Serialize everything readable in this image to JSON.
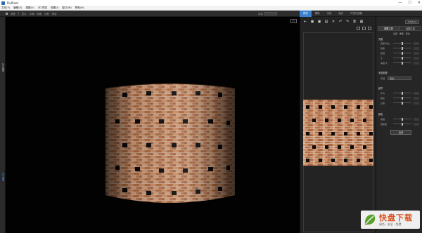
{
  "window": {
    "title": "PixPlant",
    "controls": [
      "—",
      "☐",
      "✕"
    ]
  },
  "menu": [
    "文件(F)",
    "编辑(E)",
    "视图(V)",
    "3D 预览",
    "视图(I)",
    "窗口(W)",
    "帮助(H)"
  ],
  "toolbar": {
    "items": [
      "遮罩",
      "显示",
      "平铺",
      "网格",
      "线框",
      "阴影"
    ],
    "quality_label": "质量"
  },
  "viewport": {
    "badge": "PV",
    "left_tab_top": "2D 视图",
    "left_tab_bottom": "3D 视图"
  },
  "panel_tabs": [
    "预览",
    "置换",
    "法线",
    "高光",
    "环境光遮蔽"
  ],
  "right_panel": {
    "size_value": "1024 px",
    "tabs": [
      "调整工具",
      "绘图工具"
    ],
    "subtabs": "设置 · 重置 · 复位",
    "section_color": "亮度",
    "sliders_1": [
      "亮度/对比",
      "饱和",
      "色调",
      "大",
      "亮度/大"
    ],
    "section_seamless": "无缝处理",
    "select_label": "平铺",
    "select_value": "自动",
    "section_detail": "细节",
    "sliders_2": [
      "平均",
      "锐化",
      "过渡"
    ],
    "section_tone": "颜色",
    "sliders_3": [
      "色相",
      "饱和度"
    ],
    "apply_button": "应用"
  },
  "watermark": {
    "title": "快盘下载",
    "slogan": "绿色 · 安全 · 免费"
  },
  "colors": {
    "accent": "#3a7fd0",
    "background": "#1e1e1e",
    "brick": "#b8764f"
  }
}
